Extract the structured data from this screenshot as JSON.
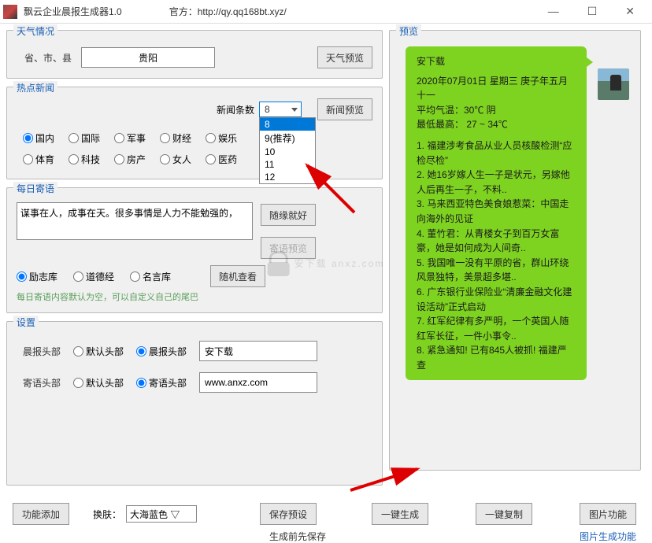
{
  "titlebar": {
    "title": "飘云企业晨报生成器1.0",
    "official_label": "官方：",
    "official_url": "http://qy.qq168bt.xyz/"
  },
  "weather": {
    "group_title": "天气情况",
    "city_label": "省、市、县",
    "city_value": "贵阳",
    "preview_btn": "天气预览"
  },
  "news": {
    "group_title": "热点新闻",
    "count_label": "新闻条数",
    "count_value": "8",
    "options": [
      "8",
      "9(推荐)",
      "10",
      "11",
      "12"
    ],
    "preview_btn": "新闻预览",
    "categories_row1": [
      "国内",
      "国际",
      "军事",
      "财经",
      "娱乐"
    ],
    "categories_row2": [
      "体育",
      "科技",
      "房产",
      "女人",
      "医药"
    ],
    "selected_category": "国内"
  },
  "jiyu": {
    "group_title": "每日寄语",
    "textarea_value": "谋事在人，成事在天。很多事情是人力不能勉强的，",
    "suiyuan_btn": "随缘就好",
    "preview_btn": "寄语预览",
    "sources": [
      "励志库",
      "道德经",
      "名言库"
    ],
    "selected_source": "励志库",
    "random_btn": "随机查看",
    "hint": "每日寄语内容默认为空，可以自定义自己的尾巴"
  },
  "settings": {
    "group_title": "设置",
    "header_label": "晨报头部",
    "header_options": [
      "默认头部",
      "晨报头部"
    ],
    "header_selected": "晨报头部",
    "header_value": "安下载",
    "jiyu_label": "寄语头部",
    "jiyu_options": [
      "默认头部",
      "寄语头部"
    ],
    "jiyu_selected": "寄语头部",
    "jiyu_value": "www.anxz.com"
  },
  "preview": {
    "group_title": "预览",
    "bubble_title": "安下载",
    "line1": "2020年07月01日   星期三   庚子年五月十一",
    "line2": "平均气温：30℃  阴",
    "line3": "最低最高： 27 ~ 34℃",
    "news_items": [
      "福建涉考食品从业人员核酸检测“应检尽检”",
      "她16岁嫁人生一子是状元，另嫁他人后再生一子，不料..",
      "马来西亚特色美食娘惹菜：中国走向海外的见证",
      "董竹君：从青楼女子到百万女富豪，她是如何成为人间奇..",
      "我国唯一没有平原的省，群山环绕风景独特，美景超多堪..",
      "广东银行业保险业“清廉金融文化建设活动”正式启动",
      "红军纪律有多严明，一个英国人随红军长征，一件小事令..",
      "紧急通知! 已有845人被抓! 福建严查"
    ]
  },
  "bottom": {
    "add_func": "功能添加",
    "skin_label": "换肤：",
    "skin_value": "大海蓝色 ▽",
    "save_preset": "保存预设",
    "generate": "一键生成",
    "copy": "一键复制",
    "image_func": "图片功能",
    "save_hint": "生成前先保存",
    "image_gen_link": "图片生成功能"
  },
  "watermark": "安下载 anxz.com"
}
